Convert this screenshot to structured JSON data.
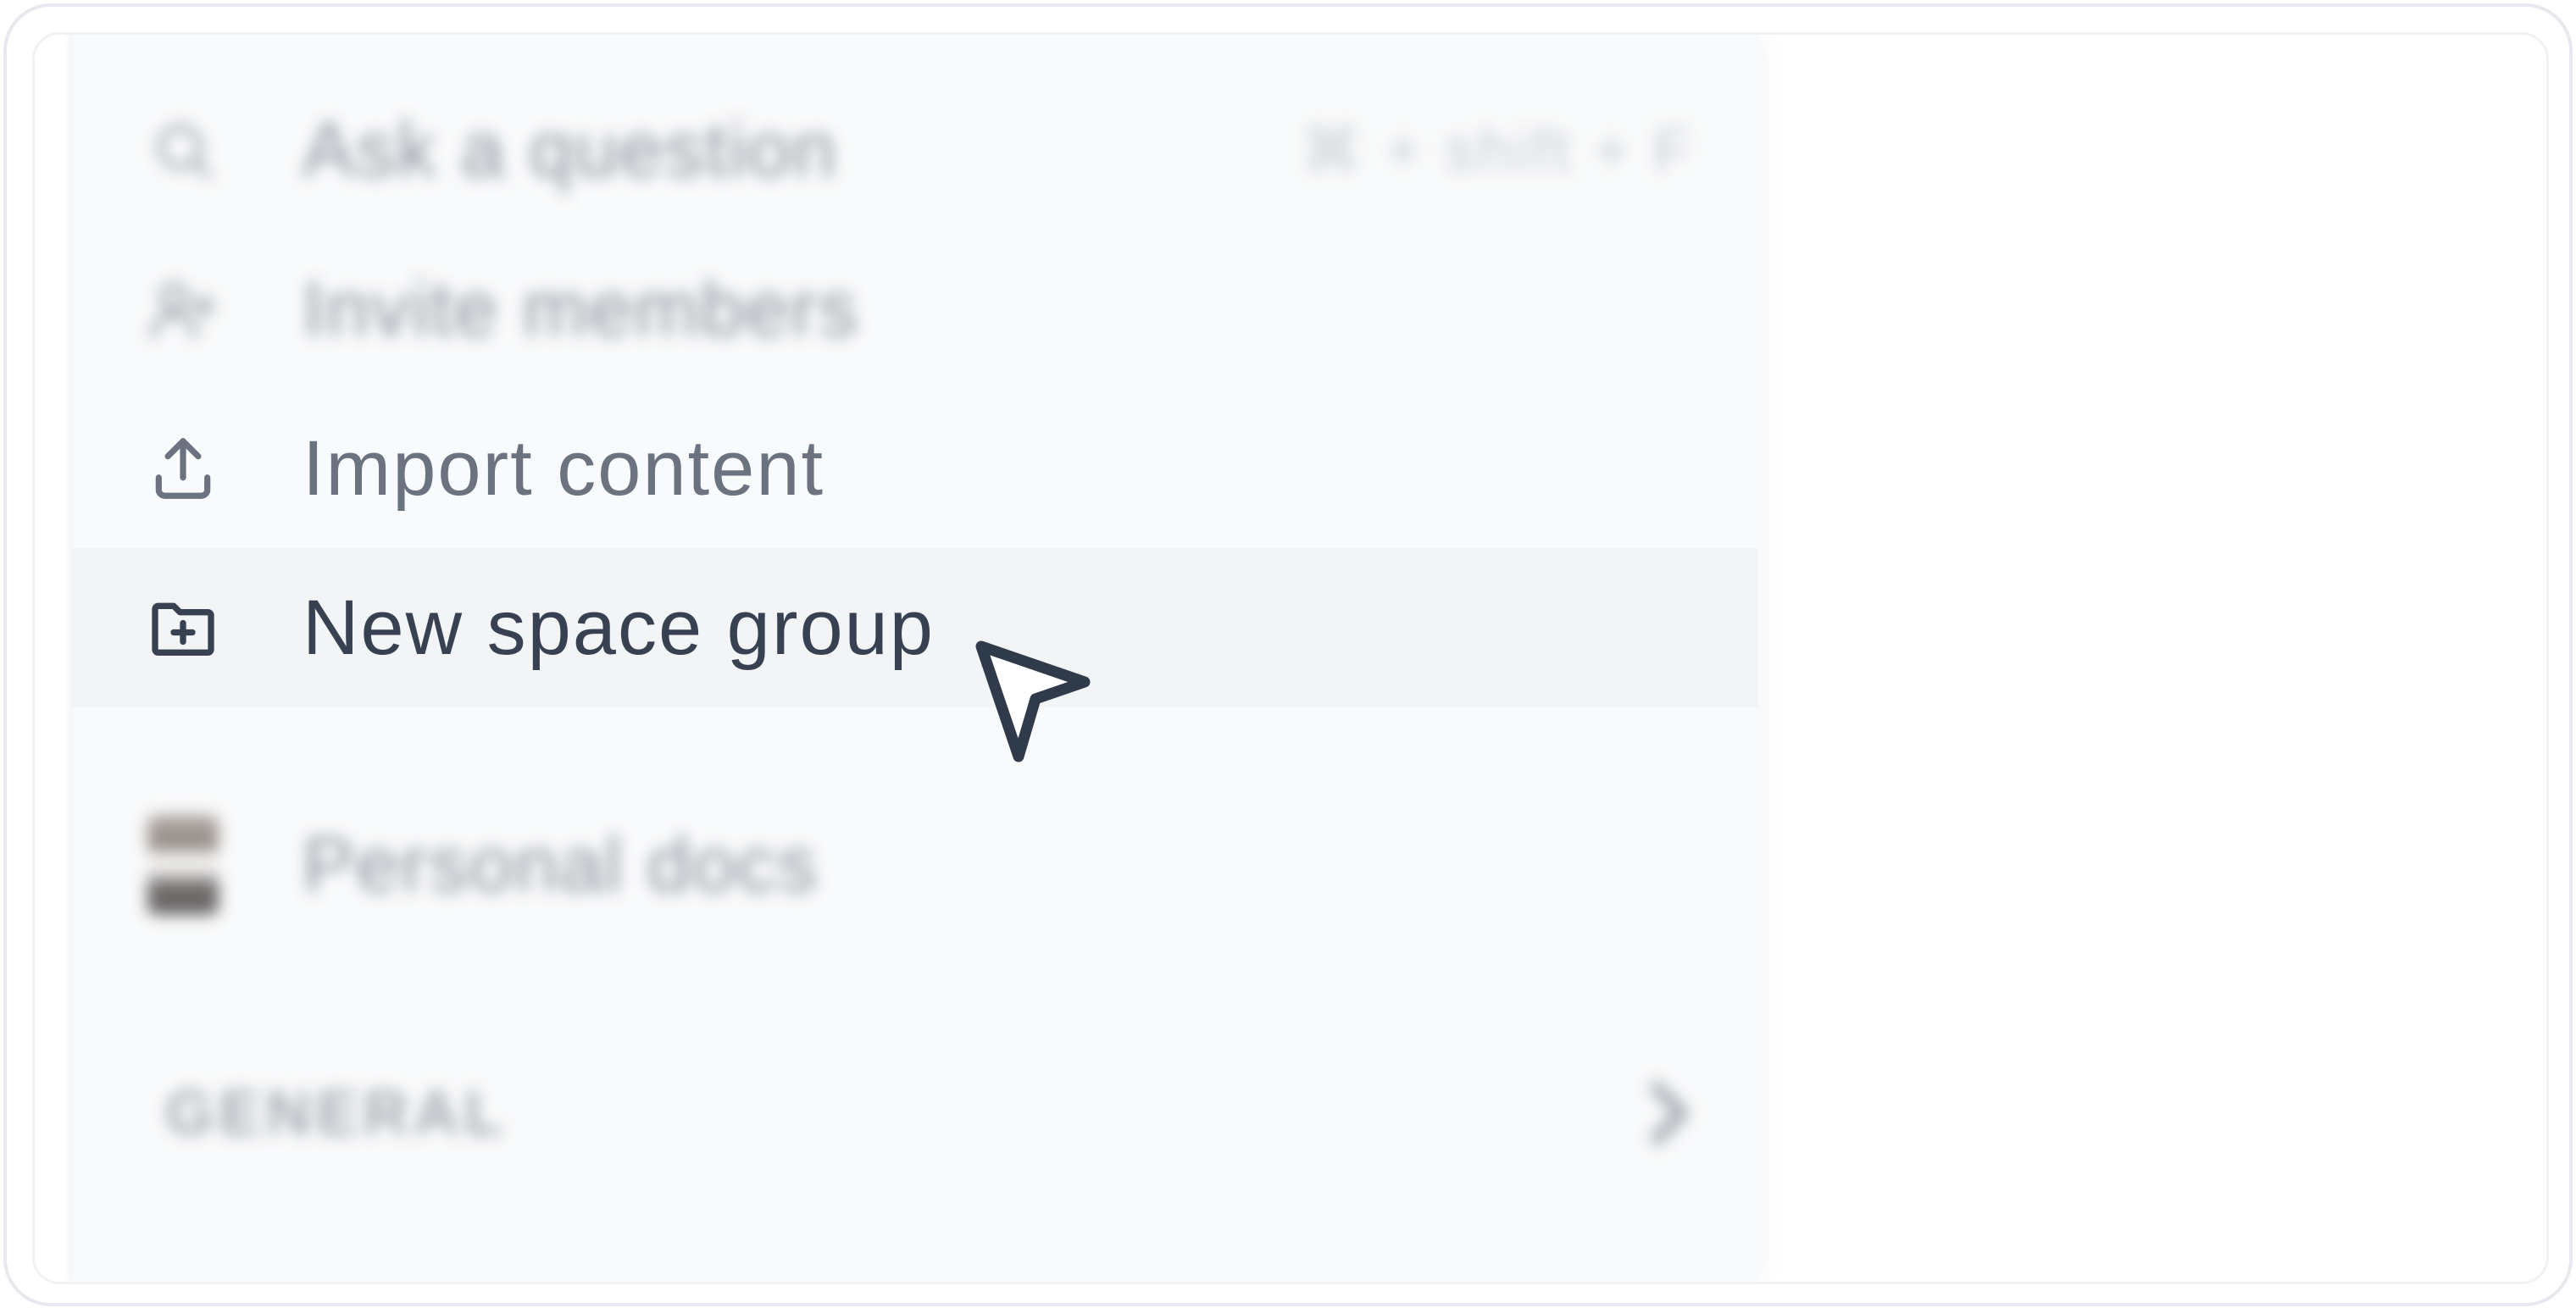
{
  "menu": {
    "items": [
      {
        "label": "Ask a question",
        "shortcut": "⌘ + shift + F",
        "icon": "search-icon"
      },
      {
        "label": "Invite members",
        "icon": "user-plus-icon"
      },
      {
        "label": "Import content",
        "icon": "upload-icon"
      },
      {
        "label": "New space group",
        "icon": "folder-plus-icon",
        "state": "hovered"
      }
    ]
  },
  "personal": {
    "label": "Personal docs",
    "icon": "avatar"
  },
  "section": {
    "label": "GENERAL",
    "icon": "chevron-right-icon"
  },
  "colors": {
    "sidebar_bg": "#f9fafb",
    "hover_bg": "#f3f4f6",
    "text_active": "#374151",
    "text_muted": "#6b7280",
    "cursor": "#2f3a4a"
  }
}
